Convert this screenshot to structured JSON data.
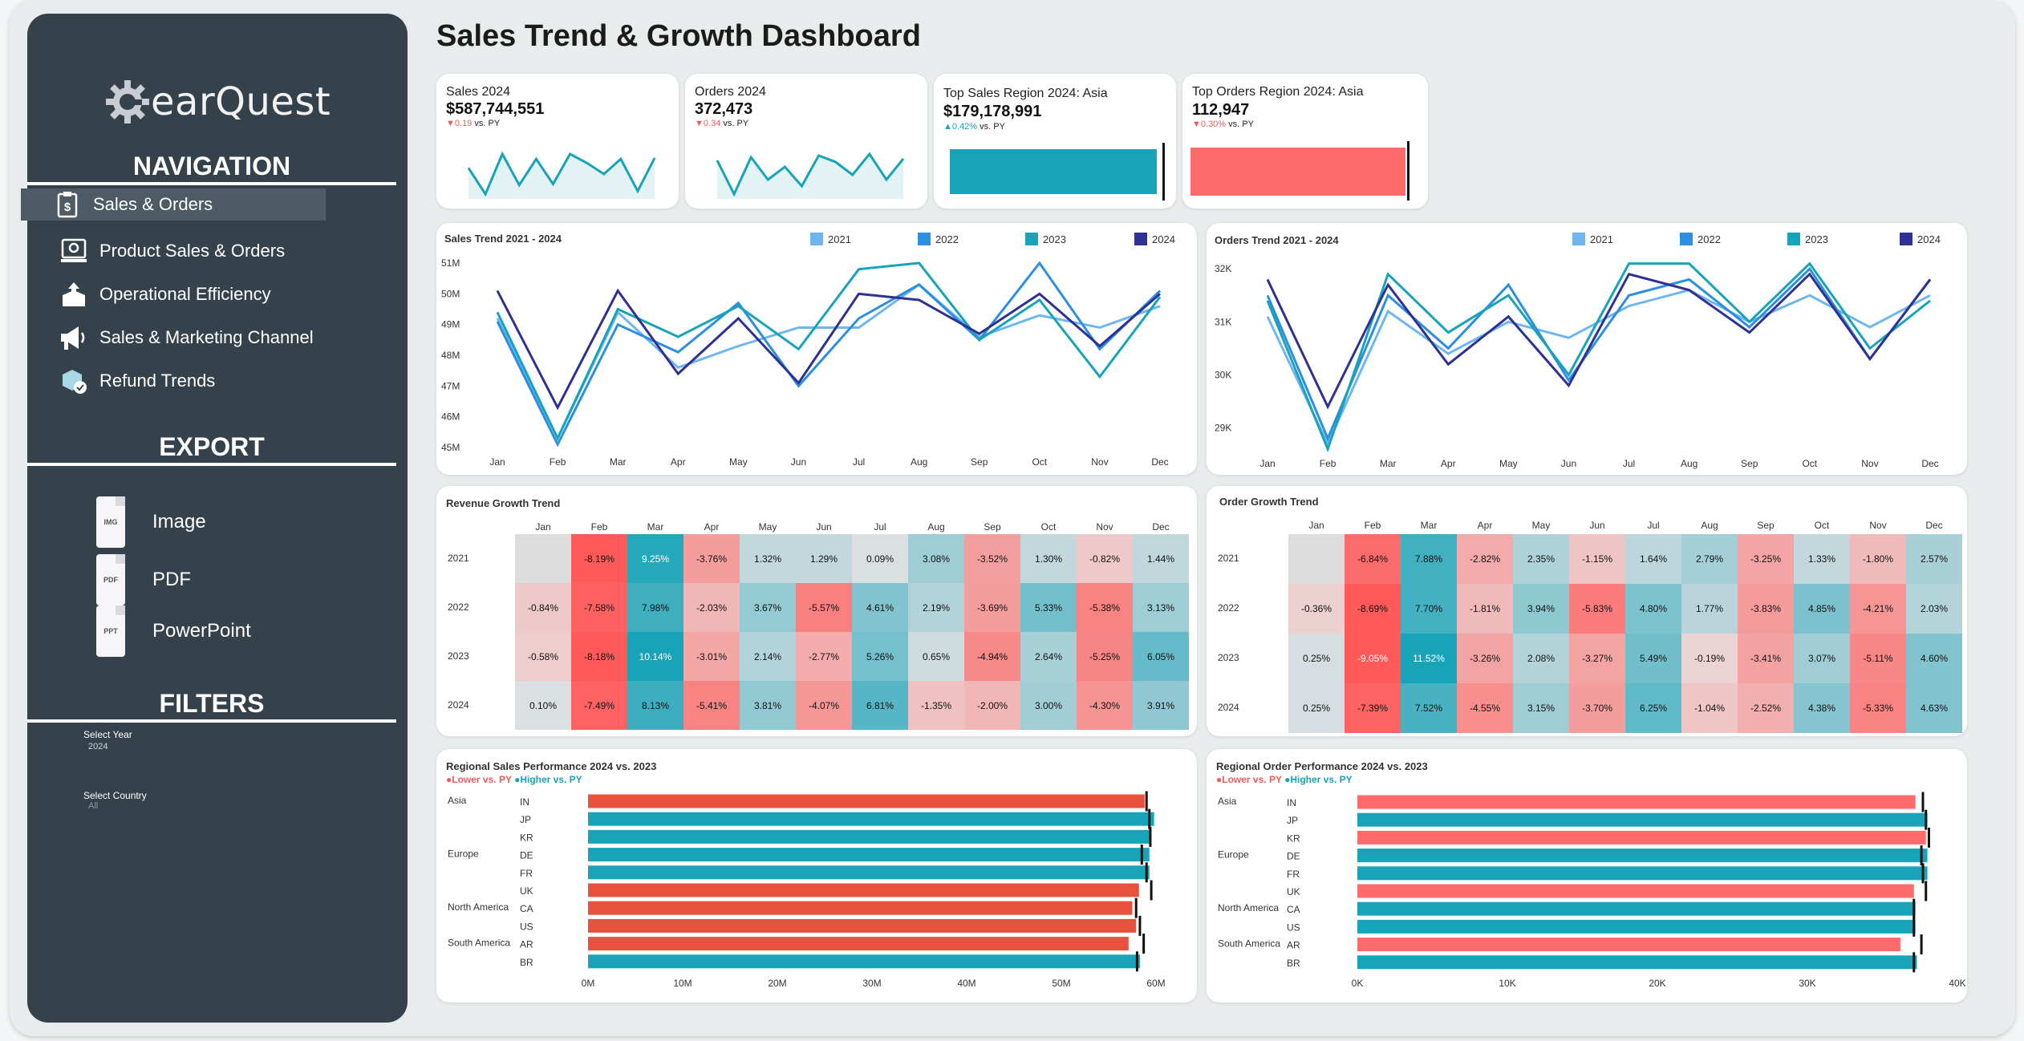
{
  "brand": {
    "name": "earQuest"
  },
  "dashboard_title": "Sales Trend & Growth Dashboard",
  "sidebar": {
    "navigation_heading": "NAVIGATION",
    "nav_items": [
      {
        "label": "Sales & Orders",
        "icon": "sales-orders-icon",
        "active": true
      },
      {
        "label": "Product Sales & Orders",
        "icon": "product-icon",
        "active": false
      },
      {
        "label": "Operational Efficiency",
        "icon": "box-upload-icon",
        "active": false
      },
      {
        "label": "Sales & Marketing Channel",
        "icon": "megaphone-icon",
        "active": false
      },
      {
        "label": "Refund Trends",
        "icon": "refund-icon",
        "active": false
      }
    ],
    "export_heading": "EXPORT",
    "export_items": [
      {
        "label": "Image",
        "tag": "IMG"
      },
      {
        "label": "PDF",
        "tag": "PDF"
      },
      {
        "label": "PowerPoint",
        "tag": "PPT"
      }
    ],
    "filters_heading": "FILTERS",
    "filters": {
      "year_label": "Select Year",
      "year_value": "2024",
      "country_label": "Select Country",
      "country_value": "All"
    }
  },
  "kpis": [
    {
      "label": "Sales 2024",
      "value": "$587,744,551",
      "delta": "0.19",
      "direction": "down",
      "suffix": " vs. PY",
      "sparkline": [
        48.5,
        45.9,
        49.9,
        46.8,
        49.4,
        46.9,
        49.9,
        49.0,
        47.9,
        49.4,
        46.2,
        49.5
      ]
    },
    {
      "label": "Orders 2024",
      "value": "372,473",
      "delta": "0.34",
      "direction": "down",
      "suffix": " vs. PY",
      "sparkline": [
        31.5,
        29.4,
        31.7,
        30.3,
        31.1,
        29.9,
        31.8,
        31.4,
        30.6,
        31.9,
        30.3,
        31.6
      ]
    },
    {
      "label": "Top Sales Region 2024: Asia",
      "value": "$179,178,991",
      "delta": "0.42%",
      "direction": "up",
      "suffix": " vs. PY",
      "bar": 0.985,
      "color": "#17a3b8"
    },
    {
      "label": "Top Orders Region 2024: Asia",
      "value": "112,947",
      "delta": "0.30%",
      "direction": "down",
      "suffix": " vs. PY",
      "bar": 0.994,
      "color": "#ff6b6b"
    }
  ],
  "colors": {
    "y2021": "#6fb6f0",
    "y2022": "#2b8ee0",
    "y2023": "#17a3b8",
    "y2024": "#2e3192",
    "higher": "#17a3b8",
    "lower": "#ef5b5b"
  },
  "chart_data": [
    {
      "type": "line",
      "title": "Sales Trend 2021 - 2024",
      "categories": [
        "Jan",
        "Feb",
        "Mar",
        "Apr",
        "May",
        "Jun",
        "Jul",
        "Aug",
        "Sep",
        "Oct",
        "Nov",
        "Dec"
      ],
      "ylim": [
        45,
        51
      ],
      "yticks": [
        "45M",
        "46M",
        "47M",
        "48M",
        "49M",
        "50M",
        "51M"
      ],
      "series": [
        {
          "name": "2021",
          "values": [
            49.2,
            45.3,
            49.4,
            47.6,
            48.3,
            48.9,
            48.9,
            50.3,
            48.6,
            49.3,
            48.9,
            49.6
          ]
        },
        {
          "name": "2022",
          "values": [
            49.1,
            45.1,
            49.0,
            48.1,
            49.7,
            47.0,
            49.2,
            50.3,
            48.5,
            51.0,
            48.2,
            50.1
          ]
        },
        {
          "name": "2023",
          "values": [
            49.4,
            45.3,
            49.5,
            48.6,
            49.6,
            48.2,
            50.8,
            51.0,
            48.5,
            49.8,
            47.3,
            49.9
          ]
        },
        {
          "name": "2024",
          "values": [
            50.1,
            46.3,
            50.1,
            47.4,
            49.2,
            47.1,
            50.0,
            49.8,
            48.7,
            50.0,
            48.3,
            50.0
          ]
        }
      ]
    },
    {
      "type": "line",
      "title": "Orders Trend 2021 - 2024",
      "categories": [
        "Jan",
        "Feb",
        "Mar",
        "Apr",
        "May",
        "Jun",
        "Jul",
        "Aug",
        "Sep",
        "Oct",
        "Nov",
        "Dec"
      ],
      "ylim": [
        28.6,
        32.2
      ],
      "yticks": [
        "29K",
        "30K",
        "31K",
        "32K"
      ],
      "yvalues": [
        29,
        30,
        31,
        32
      ],
      "series": [
        {
          "name": "2021",
          "values": [
            31.1,
            28.7,
            31.2,
            30.4,
            31.0,
            30.7,
            31.3,
            31.6,
            31.0,
            31.5,
            30.9,
            31.5
          ]
        },
        {
          "name": "2022",
          "values": [
            31.5,
            28.8,
            31.5,
            30.5,
            31.7,
            29.9,
            31.5,
            31.8,
            30.9,
            32.0,
            30.3,
            31.8
          ]
        },
        {
          "name": "2023",
          "values": [
            31.4,
            28.6,
            31.9,
            30.8,
            31.5,
            30.0,
            32.1,
            32.1,
            31.0,
            32.1,
            30.5,
            31.4
          ]
        },
        {
          "name": "2024",
          "values": [
            31.8,
            29.4,
            31.7,
            30.2,
            31.1,
            29.8,
            31.9,
            31.6,
            30.8,
            31.9,
            30.3,
            31.8
          ]
        }
      ]
    },
    {
      "type": "heatmap",
      "title": "Revenue Growth Trend",
      "columns": [
        "Jan",
        "Feb",
        "Mar",
        "Apr",
        "May",
        "Jun",
        "Jul",
        "Aug",
        "Sep",
        "Oct",
        "Nov",
        "Dec"
      ],
      "rows": [
        "2021",
        "2022",
        "2023",
        "2024"
      ],
      "values": [
        [
          null,
          -8.19,
          9.25,
          -3.76,
          1.32,
          1.29,
          0.09,
          3.08,
          -3.52,
          1.3,
          -0.82,
          1.44
        ],
        [
          -0.84,
          -7.58,
          7.98,
          -2.03,
          3.67,
          -5.57,
          4.61,
          2.19,
          -3.69,
          5.33,
          -5.38,
          3.13
        ],
        [
          -0.58,
          -8.18,
          10.14,
          -3.01,
          2.14,
          -2.77,
          5.26,
          0.65,
          -4.94,
          2.64,
          -5.25,
          6.05
        ],
        [
          0.1,
          -7.49,
          8.13,
          -5.41,
          3.81,
          -4.07,
          6.81,
          -1.35,
          -2.0,
          3.0,
          -4.3,
          3.91
        ]
      ]
    },
    {
      "type": "heatmap",
      "title": "Order Growth Trend",
      "columns": [
        "Jan",
        "Feb",
        "Mar",
        "Apr",
        "May",
        "Jun",
        "Jul",
        "Aug",
        "Sep",
        "Oct",
        "Nov",
        "Dec"
      ],
      "rows": [
        "2021",
        "2022",
        "2023",
        "2024"
      ],
      "values": [
        [
          null,
          -6.84,
          7.88,
          -2.82,
          2.35,
          -1.15,
          1.64,
          2.79,
          -3.25,
          1.33,
          -1.8,
          2.57
        ],
        [
          -0.36,
          -8.69,
          7.7,
          -1.81,
          3.94,
          -5.83,
          4.8,
          1.77,
          -3.83,
          4.85,
          -4.21,
          2.03
        ],
        [
          0.25,
          -9.05,
          11.52,
          -3.26,
          2.08,
          -3.27,
          5.49,
          -0.19,
          -3.41,
          3.07,
          -5.11,
          4.6
        ],
        [
          0.25,
          -7.39,
          7.52,
          -4.55,
          3.15,
          -3.7,
          6.25,
          -1.04,
          -2.52,
          4.38,
          -5.33,
          4.63
        ]
      ]
    },
    {
      "type": "bar",
      "title": "Regional Sales Performance 2024 vs. 2023",
      "legend_lower": "Lower vs. PY",
      "legend_higher": "Higher vs. PY",
      "xlim": [
        0,
        60
      ],
      "xticks": [
        "0M",
        "10M",
        "20M",
        "30M",
        "40M",
        "50M",
        "60M"
      ],
      "rows": [
        {
          "region": "Asia",
          "country": "IN",
          "value": 58.8,
          "prev": 59.0,
          "higher": false
        },
        {
          "region": "",
          "country": "JP",
          "value": 59.8,
          "prev": 59.3,
          "higher": true
        },
        {
          "region": "",
          "country": "KR",
          "value": 59.5,
          "prev": 59.4,
          "higher": true
        },
        {
          "region": "Europe",
          "country": "DE",
          "value": 59.3,
          "prev": 58.5,
          "higher": true
        },
        {
          "region": "",
          "country": "FR",
          "value": 59.3,
          "prev": 59.0,
          "higher": true
        },
        {
          "region": "",
          "country": "UK",
          "value": 58.2,
          "prev": 59.5,
          "higher": false
        },
        {
          "region": "North America",
          "country": "CA",
          "value": 57.5,
          "prev": 57.9,
          "higher": false
        },
        {
          "region": "",
          "country": "US",
          "value": 57.9,
          "prev": 58.3,
          "higher": false
        },
        {
          "region": "South America",
          "country": "AR",
          "value": 57.1,
          "prev": 58.7,
          "higher": false
        },
        {
          "region": "",
          "country": "BR",
          "value": 58.3,
          "prev": 58.0,
          "higher": true
        }
      ]
    },
    {
      "type": "bar",
      "title": "Regional Order Performance 2024 vs. 2023",
      "legend_lower": "Lower vs. PY",
      "legend_higher": "Higher vs. PY",
      "xlim": [
        0,
        40
      ],
      "xticks": [
        "0K",
        "10K",
        "20K",
        "30K",
        "40K"
      ],
      "rows": [
        {
          "region": "Asia",
          "country": "IN",
          "value": 37.2,
          "prev": 37.7,
          "higher": false
        },
        {
          "region": "",
          "country": "JP",
          "value": 38.0,
          "prev": 37.9,
          "higher": true
        },
        {
          "region": "",
          "country": "KR",
          "value": 37.9,
          "prev": 38.1,
          "higher": false
        },
        {
          "region": "Europe",
          "country": "DE",
          "value": 38.0,
          "prev": 37.6,
          "higher": true
        },
        {
          "region": "",
          "country": "FR",
          "value": 38.0,
          "prev": 37.7,
          "higher": true
        },
        {
          "region": "",
          "country": "UK",
          "value": 37.1,
          "prev": 37.9,
          "higher": false
        },
        {
          "region": "North America",
          "country": "CA",
          "value": 37.2,
          "prev": 37.1,
          "higher": true
        },
        {
          "region": "",
          "country": "US",
          "value": 37.2,
          "prev": 37.1,
          "higher": true
        },
        {
          "region": "South America",
          "country": "AR",
          "value": 36.2,
          "prev": 37.6,
          "higher": false
        },
        {
          "region": "",
          "country": "BR",
          "value": 37.3,
          "prev": 37.1,
          "higher": true
        }
      ]
    }
  ]
}
